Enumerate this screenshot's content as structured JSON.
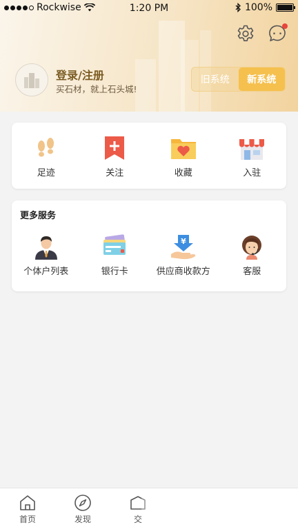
{
  "status_bar": {
    "carrier": "Rockwise",
    "time": "1:20 PM",
    "battery": "100%",
    "battery_level": 1.0
  },
  "header": {
    "login_title": "登录/注册",
    "login_subtitle": "买石材，就上石头城!",
    "system_switch": {
      "old": "旧系统",
      "new": "新系统",
      "selected": "新系统"
    },
    "message_badge_color": "#e8453c"
  },
  "quick_actions": [
    {
      "label": "足迹",
      "icon": "footprints-icon"
    },
    {
      "label": "关注",
      "icon": "bookmark-plus-icon"
    },
    {
      "label": "收藏",
      "icon": "heart-folder-icon"
    },
    {
      "label": "入驻",
      "icon": "storefront-icon"
    }
  ],
  "services": {
    "title": "更多服务",
    "items": [
      {
        "label": "个体户列表",
        "icon": "businessman-icon"
      },
      {
        "label": "银行卡",
        "icon": "bank-card-icon"
      },
      {
        "label": "供应商收款方",
        "icon": "yuan-receive-icon"
      },
      {
        "label": "客服",
        "icon": "customer-service-icon"
      }
    ]
  },
  "tabbar": {
    "items": [
      {
        "label": "首页",
        "icon": "home-icon"
      },
      {
        "label": "发现",
        "icon": "compass-icon"
      },
      {
        "label": "交",
        "icon": "trade-icon"
      }
    ]
  },
  "colors": {
    "accent": "#f5c04e",
    "header_gradient_start": "#fbf5eb",
    "header_gradient_end": "#f2d39e",
    "login_title": "#7b5c23"
  }
}
